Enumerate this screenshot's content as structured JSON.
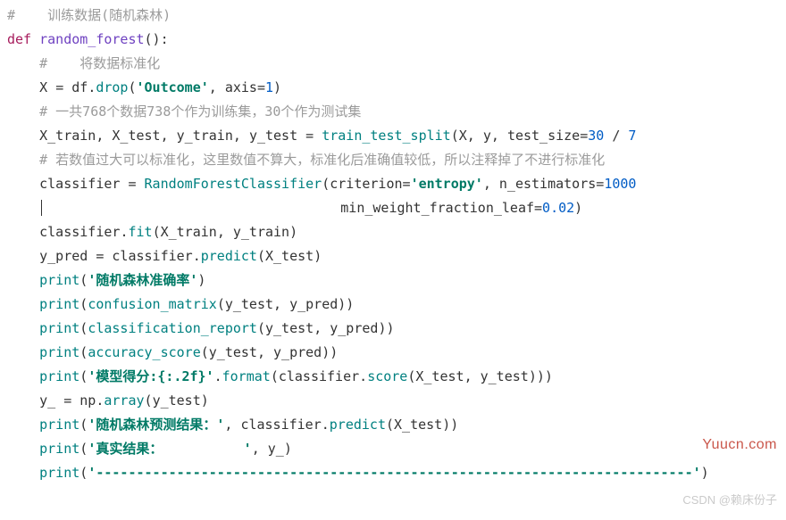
{
  "comments": {
    "c1": "#    训练数据(随机森林)",
    "c2": "#    将数据标准化",
    "c3": "# 一共768个数据738个作为训练集，30个作为测试集",
    "c4": "# 若数值过大可以标准化，这里数值不算大，标准化后准确值较低，所以注释掉了不进行标准化"
  },
  "kw": {
    "def": "def"
  },
  "func": {
    "name": "random_forest"
  },
  "ids": {
    "X": "X",
    "df": "df",
    "X_train": "X_train",
    "X_test": "X_test",
    "y_train": "y_train",
    "y_test": "y_test",
    "classifier": "classifier",
    "y_pred": "y_pred",
    "y_": "y_",
    "np": "np",
    "X_arg": "X",
    "y_arg": "y"
  },
  "calls": {
    "drop": "drop",
    "train_test_split": "train_test_split",
    "RandomForestClassifier": "RandomForestClassifier",
    "fit": "fit",
    "predict": "predict",
    "print": "print",
    "confusion_matrix": "confusion_matrix",
    "classification_report": "classification_report",
    "accuracy_score": "accuracy_score",
    "format": "format",
    "score": "score",
    "array": "array"
  },
  "kwargs": {
    "axis": "axis",
    "test_size": "test_size",
    "criterion": "criterion",
    "n_estimators": "n_estimators",
    "min_weight_fraction_leaf": "min_weight_fraction_leaf"
  },
  "nums": {
    "one": "1",
    "thirty": "30",
    "slash_tail": "7",
    "thousand": "1000",
    "zero02": "0.02"
  },
  "strs": {
    "outcome": "'Outcome'",
    "entropy": "'entropy'",
    "rf_acc": "'随机森林准确率'",
    "model_score": "'模型得分:{:.2f}'",
    "rf_pred": "'随机森林预测结果：'",
    "real_res": "'真实结果：          '",
    "dash_line": "'--------------------------------------------------------------------------'"
  },
  "watermarks": {
    "red": "Yuucn.com",
    "grey": "CSDN @赖床份子"
  }
}
